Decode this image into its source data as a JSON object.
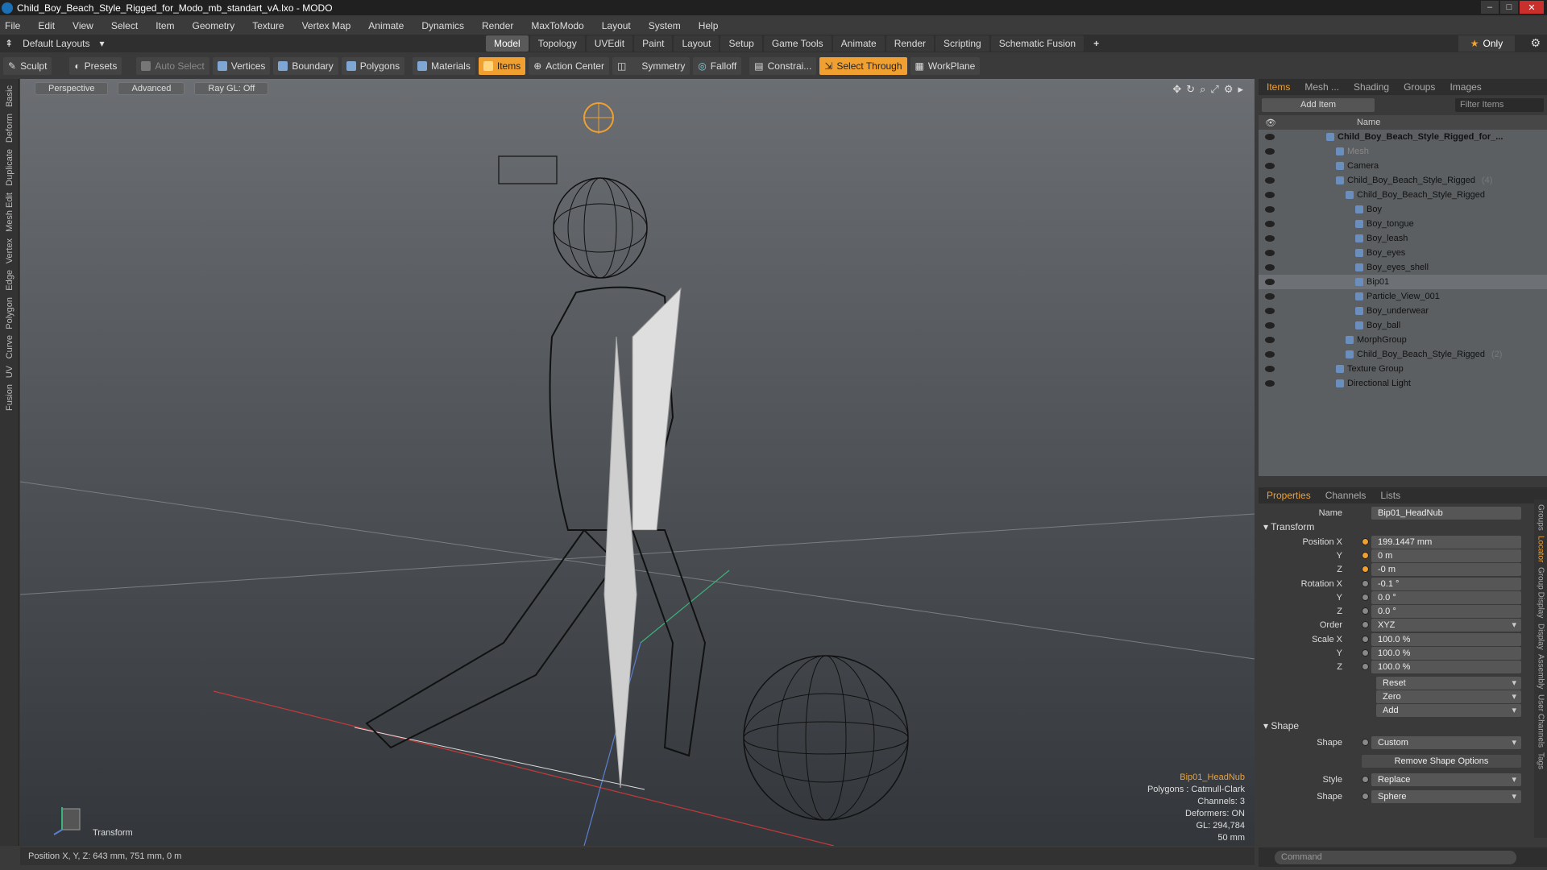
{
  "window": {
    "title": "Child_Boy_Beach_Style_Rigged_for_Modo_mb_standart_vA.lxo - MODO"
  },
  "menu": [
    "File",
    "Edit",
    "View",
    "Select",
    "Item",
    "Geometry",
    "Texture",
    "Vertex Map",
    "Animate",
    "Dynamics",
    "Render",
    "MaxToModo",
    "Layout",
    "System",
    "Help"
  ],
  "layout": {
    "selector": "Default Layouts",
    "only": "Only"
  },
  "tabs": [
    "Model",
    "Topology",
    "UVEdit",
    "Paint",
    "Layout",
    "Setup",
    "Game Tools",
    "Animate",
    "Render",
    "Scripting",
    "Schematic Fusion"
  ],
  "active_tab": "Model",
  "toolbar": {
    "sculpt": "Sculpt",
    "presets": "Presets",
    "auto_select": "Auto Select",
    "vertices": "Vertices",
    "boundary": "Boundary",
    "polygons": "Polygons",
    "materials": "Materials",
    "items": "Items",
    "action_center": "Action Center",
    "symmetry": "Symmetry",
    "falloff": "Falloff",
    "constrain": "Constrai...",
    "select_through": "Select Through",
    "workplane": "WorkPlane"
  },
  "left_tabs": [
    "Basic",
    "Deform",
    "Duplicate",
    "Mesh Edit",
    "Vertex",
    "Edge",
    "Polygon",
    "Curve",
    "UV",
    "Fusion"
  ],
  "viewport": {
    "perspective": "Perspective",
    "advanced": "Advanced",
    "raygl": "Ray GL: Off",
    "info": {
      "selected": "Bip01_HeadNub",
      "polygons": "Polygons : Catmull-Clark",
      "channels": "Channels: 3",
      "deformers": "Deformers: ON",
      "gl": "GL: 294,784",
      "size": "50 mm"
    },
    "transform_label": "Transform"
  },
  "status": "Position X, Y, Z:   643 mm, 751 mm, 0 m",
  "items_panel": {
    "tabs": [
      "Items",
      "Mesh ...",
      "Shading",
      "Groups",
      "Images"
    ],
    "add_item": "Add Item",
    "filter": "Filter Items",
    "name_col": "Name",
    "rows": [
      {
        "label": "Child_Boy_Beach_Style_Rigged_for_...",
        "indent": 0,
        "bold": true
      },
      {
        "label": "Mesh",
        "indent": 1,
        "dim": true
      },
      {
        "label": "Camera",
        "indent": 1
      },
      {
        "label": "Child_Boy_Beach_Style_Rigged",
        "indent": 1,
        "count": "(4)"
      },
      {
        "label": "Child_Boy_Beach_Style_Rigged",
        "indent": 2
      },
      {
        "label": "Boy",
        "indent": 3
      },
      {
        "label": "Boy_tongue",
        "indent": 3
      },
      {
        "label": "Boy_leash",
        "indent": 3
      },
      {
        "label": "Boy_eyes",
        "indent": 3
      },
      {
        "label": "Boy_eyes_shell",
        "indent": 3
      },
      {
        "label": "Bip01",
        "indent": 3,
        "sel": true
      },
      {
        "label": "Particle_View_001",
        "indent": 3
      },
      {
        "label": "Boy_underwear",
        "indent": 3
      },
      {
        "label": "Boy_ball",
        "indent": 3
      },
      {
        "label": "MorphGroup",
        "indent": 2
      },
      {
        "label": "Child_Boy_Beach_Style_Rigged",
        "indent": 2,
        "count": "(2)"
      },
      {
        "label": "Texture Group",
        "indent": 1
      },
      {
        "label": "Directional Light",
        "indent": 1
      }
    ]
  },
  "properties": {
    "tabs": [
      "Properties",
      "Channels",
      "Lists"
    ],
    "name_label": "Name",
    "name_value": "Bip01_HeadNub",
    "transform": "Transform",
    "position_x": "199.1447 mm",
    "position_y": "0 m",
    "position_z": "-0 m",
    "rotation_x": "-0.1 °",
    "rotation_y": "0.0 °",
    "rotation_z": "0.0 °",
    "order": "XYZ",
    "scale_x": "100.0 %",
    "scale_y": "100.0 %",
    "scale_z": "100.0 %",
    "reset": "Reset",
    "zero": "Zero",
    "add": "Add",
    "shape_section": "Shape",
    "shape": "Custom",
    "remove_shape": "Remove Shape Options",
    "style": "Replace",
    "shape2": "Sphere",
    "labels": {
      "position_x": "Position X",
      "y": "Y",
      "z": "Z",
      "rotation_x": "Rotation X",
      "order": "Order",
      "scale_x": "Scale X",
      "shape": "Shape",
      "style": "Style"
    },
    "side_tabs": [
      "Groups",
      "Locator",
      "Group Display",
      "Display",
      "Assembly",
      "User Channels",
      "Tags"
    ]
  },
  "command": "Command"
}
